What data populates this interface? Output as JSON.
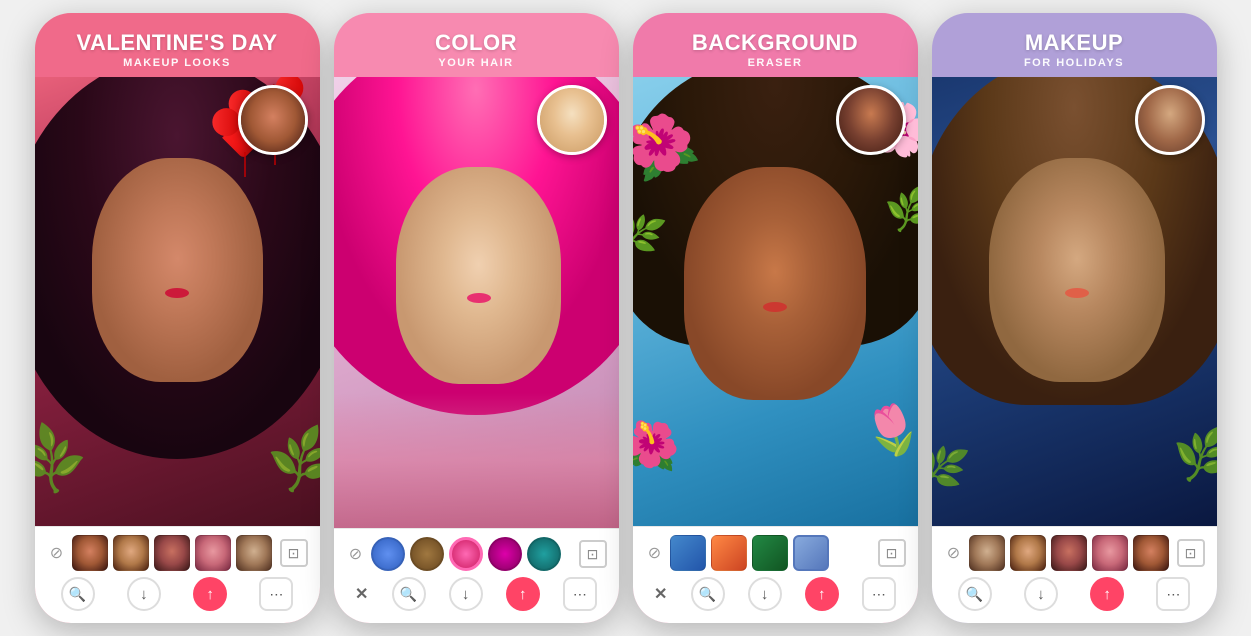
{
  "phones": [
    {
      "id": "phone-1",
      "title": "VALENTINE'S DAY",
      "subtitle": "MAKEUP LOOKS",
      "background": "#f06a8a",
      "theme": "valentine"
    },
    {
      "id": "phone-2",
      "title": "COLOR",
      "subtitle": "YOUR HAIR",
      "background": "#f78ab0",
      "theme": "color-hair"
    },
    {
      "id": "phone-3",
      "title": "BACKGROUND",
      "subtitle": "ERASER",
      "background": "#f07aaa",
      "theme": "background-eraser"
    },
    {
      "id": "phone-4",
      "title": "MAKEUP",
      "subtitle": "FOR HOLIDAYS",
      "background": "#b0a0d8",
      "theme": "makeup"
    }
  ],
  "toolbar": {
    "cancel_icon": "✕",
    "compare_icon": "⊡",
    "download_icon": "↓",
    "share_icon": "↑",
    "more_icon": "⋯"
  }
}
